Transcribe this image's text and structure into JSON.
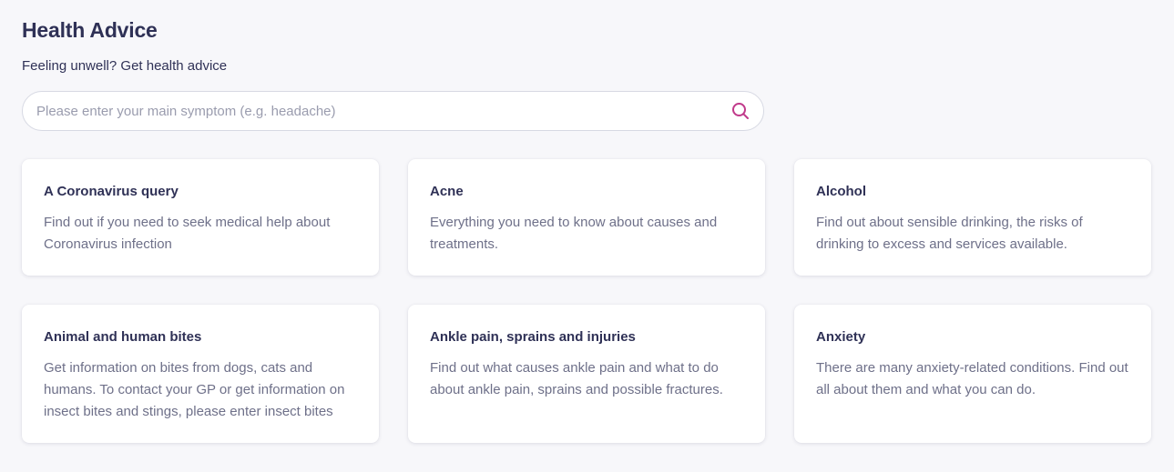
{
  "header": {
    "title": "Health Advice",
    "subtitle": "Feeling unwell? Get health advice"
  },
  "search": {
    "placeholder": "Please enter your main symptom (e.g. headache)",
    "value": "",
    "icon": "search-icon"
  },
  "colors": {
    "accent": "#c0398a",
    "heading": "#2f3156",
    "body_text": "#6e7089",
    "background": "#f7f7fa",
    "card": "#ffffff"
  },
  "cards": [
    {
      "title": "A Coronavirus query",
      "description": "Find out if you need to seek medical help about Coronavirus infection"
    },
    {
      "title": "Acne",
      "description": "Everything you need to know about causes and treatments."
    },
    {
      "title": "Alcohol",
      "description": "Find out about sensible drinking, the risks of drinking to excess and services available."
    },
    {
      "title": "Animal and human bites",
      "description": "Get information on bites from dogs, cats and humans. To contact your GP or get information on insect bites and stings, please enter insect bites"
    },
    {
      "title": "Ankle pain, sprains and injuries",
      "description": "Find out what causes ankle pain and what to do about ankle pain, sprains and possible fractures."
    },
    {
      "title": "Anxiety",
      "description": "There are many anxiety-related conditions. Find out all about them and what you can do."
    }
  ]
}
